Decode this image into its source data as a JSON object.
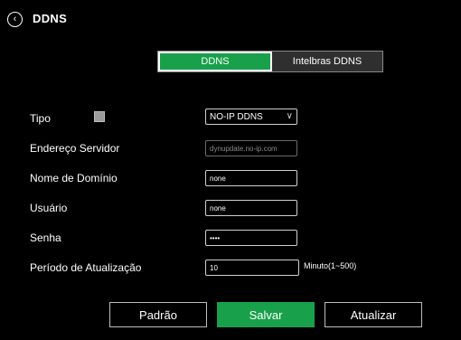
{
  "header": {
    "title": "DDNS",
    "back_icon": "chevron-left-circle-icon"
  },
  "tabs": [
    {
      "label": "DDNS",
      "active": true
    },
    {
      "label": "Intelbras DDNS",
      "active": false
    }
  ],
  "form": {
    "tipo": {
      "label": "Tipo",
      "enabled": false,
      "selected": "NO-IP DDNS"
    },
    "endereco_servidor": {
      "label": "Endereço Servidor",
      "placeholder": "dynupdate.no-ip.com"
    },
    "nome_dominio": {
      "label": "Nome de Domínio",
      "value": "none"
    },
    "usuario": {
      "label": "Usuário",
      "value": "none"
    },
    "senha": {
      "label": "Senha",
      "value": "••••"
    },
    "periodo": {
      "label": "Período de Atualização",
      "value": "10",
      "unit": "Minuto(1~500)"
    }
  },
  "buttons": {
    "padrao": "Padrão",
    "salvar": "Salvar",
    "atualizar": "Atualizar"
  },
  "colors": {
    "accent": "#19a04b",
    "background": "#000000",
    "text": "#ffffff"
  }
}
